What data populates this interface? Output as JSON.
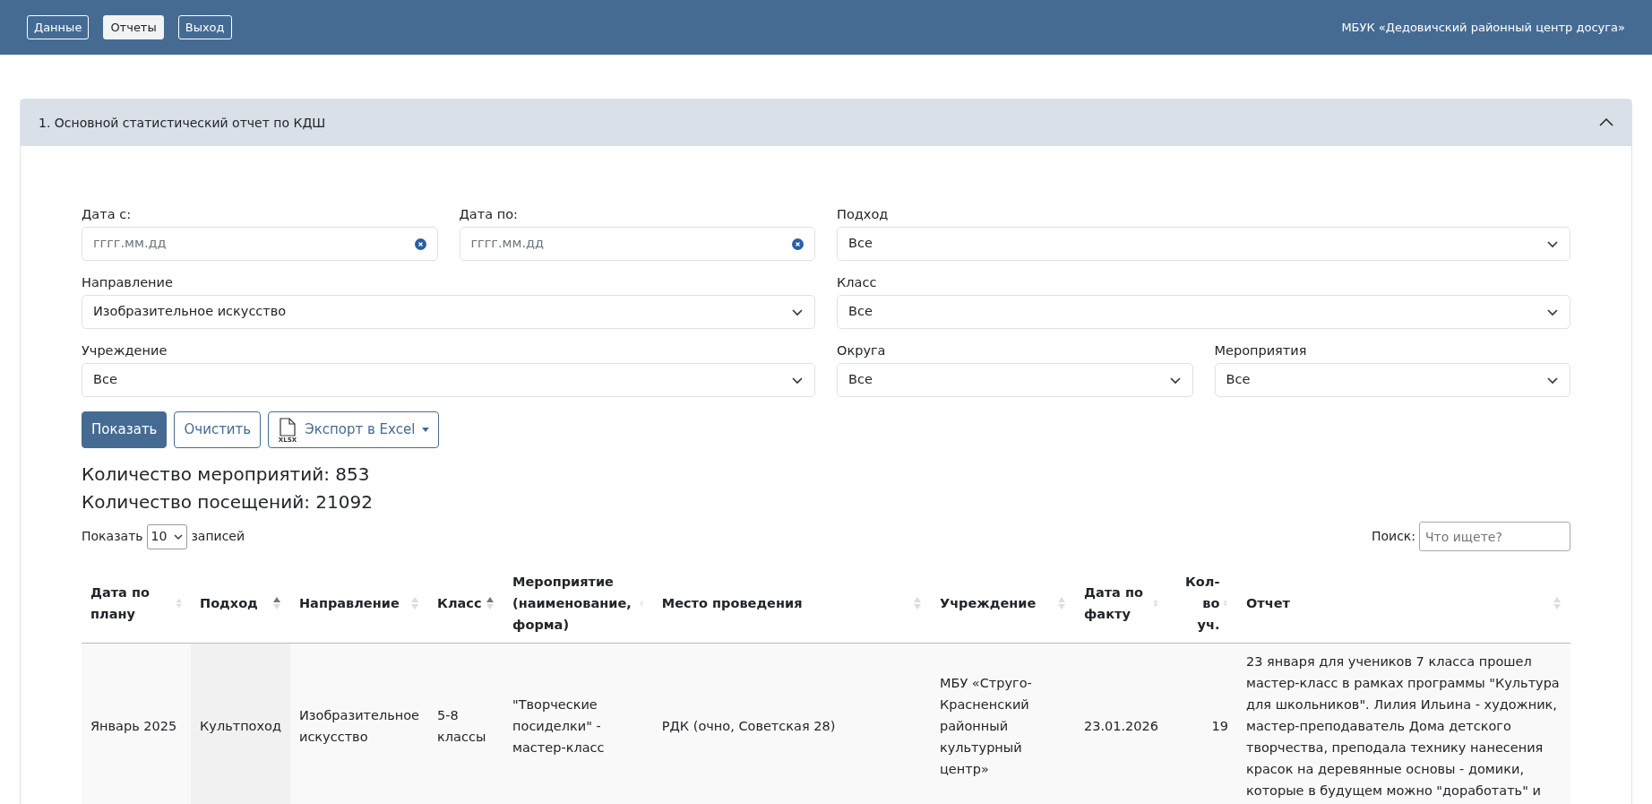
{
  "navbar": {
    "buttons": [
      {
        "label": "Данные",
        "selected": false
      },
      {
        "label": "Отчеты",
        "selected": true
      },
      {
        "label": "Выход",
        "selected": false
      }
    ],
    "org": "МБУК «Дедовичский районный центр досуга»"
  },
  "report": {
    "title": "1. Основной статистический отчет по КДШ",
    "expanded": true,
    "filters": [
      {
        "kind": "date",
        "label": "Дата с:",
        "placeholder": "гггг.мм.дд"
      },
      {
        "kind": "date",
        "label": "Дата по:",
        "placeholder": "гггг.мм.дд"
      },
      {
        "kind": "select",
        "label": "Подход",
        "value": "Все"
      },
      {
        "kind": "select",
        "label": "Направление",
        "value": "Изобразительное искусство"
      },
      {
        "kind": "select",
        "label": "Класс",
        "value": "Все"
      },
      {
        "kind": "select",
        "label": "Учреждение",
        "value": "Все"
      },
      {
        "kind": "select",
        "label": "Округа",
        "value": "Все"
      },
      {
        "kind": "select",
        "label": "Мероприятия",
        "value": "Все"
      }
    ],
    "buttons": [
      {
        "kind": "primary",
        "label": "Показать"
      },
      {
        "kind": "outline",
        "label": "Очистить"
      },
      {
        "kind": "export",
        "label": "Экспорт в Excel",
        "icon_label": "XLSX"
      }
    ],
    "counts": [
      "Количество мероприятий: 853",
      "Количество посещений: 21092"
    ],
    "length": {
      "before": "Показать",
      "value": "10",
      "after": "записей"
    },
    "search": {
      "label": "Поиск:",
      "placeholder": "Что ищете?"
    },
    "table": {
      "columns": [
        {
          "label": "Дата по плану",
          "sorted": false
        },
        {
          "label": "Подход",
          "sorted": true,
          "highlighted": true
        },
        {
          "label": "Направление",
          "sorted": false
        },
        {
          "label": "Класс",
          "sorted": true
        },
        {
          "label": "Мероприятие (наименование, форма)",
          "sorted": false
        },
        {
          "label": "Место проведения",
          "sorted": false
        },
        {
          "label": "Учреждение",
          "sorted": false
        },
        {
          "label": "Дата по факту",
          "sorted": false
        },
        {
          "label": "Кол-во уч.",
          "sorted": false
        },
        {
          "label": "Отчет",
          "sorted": false
        }
      ],
      "rows": [
        [
          "Январь 2025",
          "Культпоход",
          "Изобразительное искусство",
          "5-8 классы",
          "\"Творческие посиделки\" - мастер-класс",
          "РДК (очно, Советская 28)",
          "МБУ «Струго-Красненский районный культурный центр»",
          "23.01.2026",
          "19",
          "23 января для учеников 7 класса прошел мастер-класс в рамках программы \"Культура для школьников\". Лилия Ильина - художник, мастер-преподаватель Дома детского творчества, преподала технику нанесения красок на деревянные основы - домики, которые в будущем можно \"доработать\" и"
        ]
      ]
    }
  }
}
